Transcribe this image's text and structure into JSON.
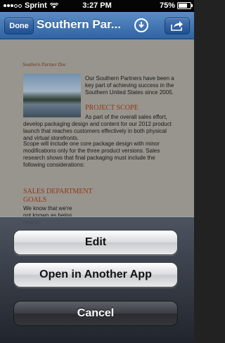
{
  "status_bar": {
    "carrier": "Sprint",
    "time": "3:27 PM",
    "battery": "75%",
    "battery_level": 0.75
  },
  "nav": {
    "done_label": "Done",
    "title": "Southern Par...",
    "download_icon": "download-icon",
    "share_icon": "share-icon"
  },
  "document": {
    "header": "Southern Partner Doc",
    "intro": "Our Southern Partners have been a key part of achieving success in the Southern United States since 2005.",
    "scope_heading": "PROJECT SCOPE",
    "scope_text": "As part of the overall sales effort, develop packaging design and content for our 2012 product launch that reaches customers effectively in both physical and virtual storefronts.",
    "scope_text2": "Scope will include one core package design with minor modifications only for the three product versions.  Sales research shows that final packaging must include the following considerations:",
    "sales_heading": "SALES DEPARTMENT GOALS",
    "sales_text": "We know that we're not known as being exactly"
  },
  "action_sheet": {
    "edit_label": "Edit",
    "open_label": "Open in Another App",
    "cancel_label": "Cancel"
  }
}
